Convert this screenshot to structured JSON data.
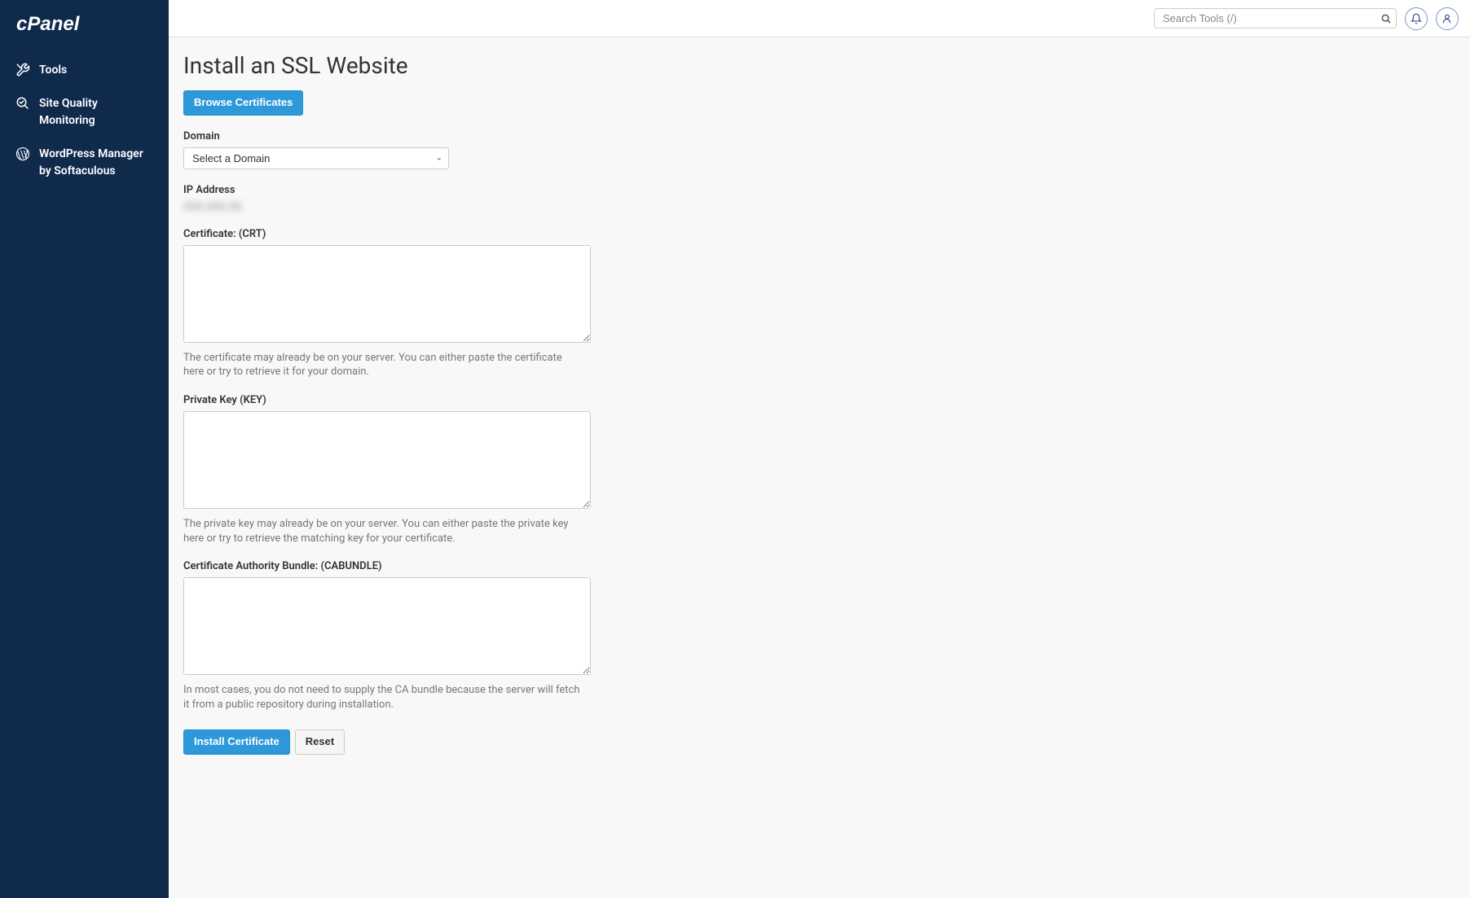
{
  "brand": "cPanel",
  "sidebar": {
    "items": [
      {
        "label": "Tools",
        "icon": "tools"
      },
      {
        "label": "Site Quality Monitoring",
        "icon": "quality"
      },
      {
        "label": "WordPress Manager by Softaculous",
        "icon": "wordpress"
      }
    ]
  },
  "header": {
    "search_placeholder": "Search Tools (/)"
  },
  "page": {
    "title": "Install an SSL Website",
    "browse_button": "Browse Certificates",
    "domain": {
      "label": "Domain",
      "placeholder": "Select a Domain"
    },
    "ip": {
      "label": "IP Address",
      "value": "XXX.XXX.XX"
    },
    "cert": {
      "label": "Certificate: (CRT)",
      "help": "The certificate may already be on your server. You can either paste the certificate here or try to retrieve it for your domain."
    },
    "key": {
      "label": "Private Key (KEY)",
      "help": "The private key may already be on your server. You can either paste the private key here or try to retrieve the matching key for your certificate."
    },
    "cabundle": {
      "label": "Certificate Authority Bundle: (CABUNDLE)",
      "help": "In most cases, you do not need to supply the CA bundle because the server will fetch it from a public repository during installation."
    },
    "actions": {
      "install": "Install Certificate",
      "reset": "Reset"
    }
  }
}
